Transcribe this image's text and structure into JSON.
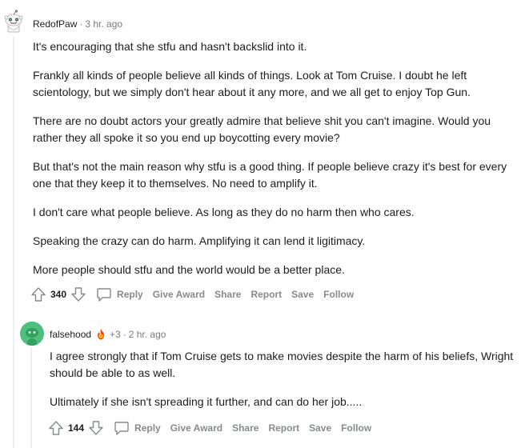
{
  "comments": [
    {
      "username": "RedofPaw",
      "separator": "·",
      "time": "3 hr. ago",
      "paragraphs": [
        "It's encouraging that she stfu and hasn't backslid into it.",
        "Frankly all kinds of people believe all kinds of things. Look at Tom Cruise. I doubt he left scientology, but we simply don't hear about it any more, and we all get to enjoy Top Gun.",
        "There are no doubt actors your greatly admire that believe shit you can't imagine. Would you rather they all spoke it so you end up boycotting every movie?",
        "But that's not the main reason why stfu is a good thing. If people believe crazy it's best for every one that they keep it to themselves. No need to amplify it.",
        "I don't care what people believe. As long as they do no harm then who cares.",
        "Speaking the crazy can do harm. Amplifying it can lend it ligitimacy.",
        "More people should stfu and the world would be a better place."
      ],
      "score": "340",
      "actions": {
        "reply": "Reply",
        "award": "Give Award",
        "share": "Share",
        "report": "Report",
        "save": "Save",
        "follow": "Follow"
      }
    },
    {
      "username": "falsehood",
      "karma": "+3",
      "separator": "·",
      "time": "2 hr. ago",
      "paragraphs": [
        "I agree strongly that if Tom Cruise gets to make movies despite the harm of his beliefs, Wright should be able to as well.",
        "Ultimately if she isn't spreading it further, and can do her job....."
      ],
      "score": "144",
      "actions": {
        "reply": "Reply",
        "award": "Give Award",
        "share": "Share",
        "report": "Report",
        "save": "Save",
        "follow": "Follow"
      }
    }
  ],
  "icons": {
    "avatar1": "snoo-avatar-icon",
    "avatar2": "snoo-avatar-icon",
    "flair": "award-flame-icon",
    "upvote": "upvote-arrow-icon",
    "downvote": "downvote-arrow-icon",
    "reply": "speech-bubble-icon"
  },
  "colors": {
    "meta": "#787c7e",
    "action": "#878a8c",
    "avatar2_bg": "#4fbf80",
    "thread_line": "#edeff1"
  }
}
